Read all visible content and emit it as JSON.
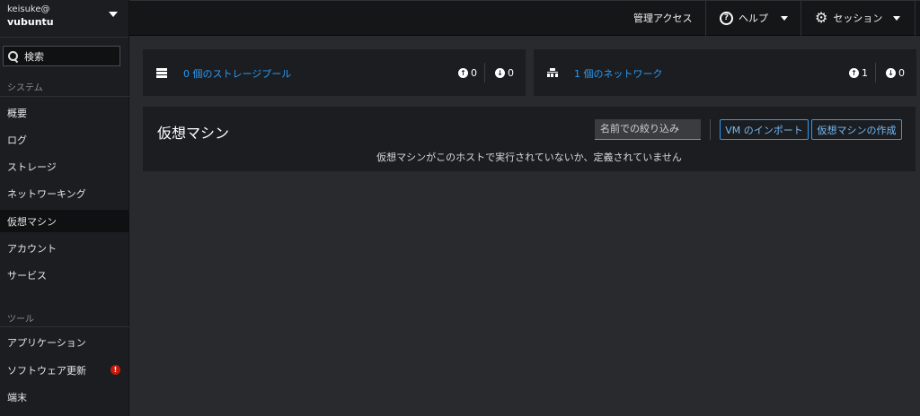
{
  "host": {
    "user": "keisuke@",
    "name": "vubuntu"
  },
  "search": {
    "label": "検索"
  },
  "sidebar": {
    "system_label": "システム",
    "system_items": [
      {
        "label": "概要"
      },
      {
        "label": "ログ"
      },
      {
        "label": "ストレージ"
      },
      {
        "label": "ネットワーキング"
      },
      {
        "label": "仮想マシン",
        "active": true
      },
      {
        "label": "アカウント"
      },
      {
        "label": "サービス"
      }
    ],
    "tools_label": "ツール",
    "tools_items": [
      {
        "label": "アプリケーション"
      },
      {
        "label": "ソフトウェア更新",
        "badge": "!"
      },
      {
        "label": "端末"
      }
    ]
  },
  "topbar": {
    "admin_access": "管理アクセス",
    "help": "ヘルプ",
    "session": "セッション"
  },
  "storage_card": {
    "link": "0 個のストレージプール",
    "active": "0",
    "inactive": "0"
  },
  "network_card": {
    "link": "1 個のネットワーク",
    "active": "1",
    "inactive": "0"
  },
  "vms": {
    "title": "仮想マシン",
    "filter_placeholder": "名前での絞り込み",
    "import_button": "VM のインポート",
    "create_button": "仮想マシンの作成",
    "empty_message": "仮想マシンがこのホストで実行されていないか、定義されていません"
  },
  "colors": {
    "accent": "#2b9af3",
    "badge": "#c9190b"
  }
}
